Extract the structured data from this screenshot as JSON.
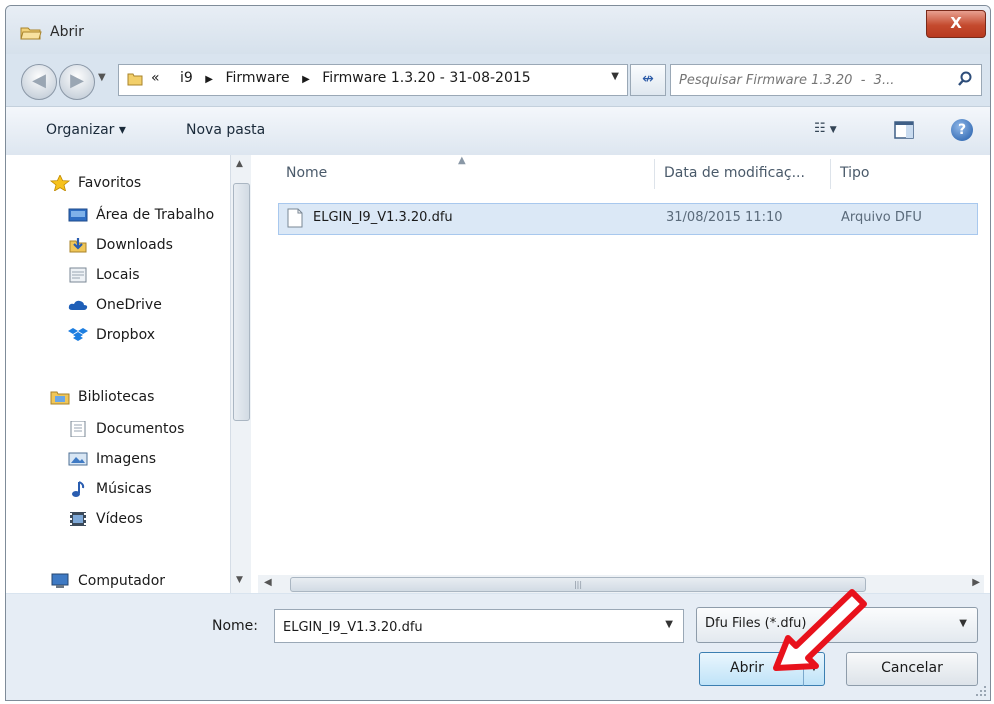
{
  "window": {
    "title": "Abrir",
    "close_label": "X"
  },
  "navbar": {
    "address": {
      "crumbs": [
        "«",
        "i9",
        "Firmware",
        "Firmware 1.3.20  -  31-08-2015"
      ]
    },
    "search_placeholder": "Pesquisar Firmware 1.3.20  -  3..."
  },
  "toolbar": {
    "organize_label": "Organizar ▾",
    "new_folder_label": "Nova pasta"
  },
  "sidebar": {
    "favorites": {
      "label": "Favoritos",
      "items": [
        {
          "label": "Área de Trabalho",
          "icon": "desktop-icon"
        },
        {
          "label": "Downloads",
          "icon": "downloads-icon"
        },
        {
          "label": "Locais",
          "icon": "recent-places-icon"
        },
        {
          "label": "OneDrive",
          "icon": "onedrive-icon"
        },
        {
          "label": "Dropbox",
          "icon": "dropbox-icon"
        }
      ]
    },
    "libraries": {
      "label": "Bibliotecas",
      "items": [
        {
          "label": "Documentos",
          "icon": "documents-icon"
        },
        {
          "label": "Imagens",
          "icon": "pictures-icon"
        },
        {
          "label": "Músicas",
          "icon": "music-icon"
        },
        {
          "label": "Vídeos",
          "icon": "videos-icon"
        }
      ]
    },
    "computer_label": "Computador"
  },
  "file_list": {
    "columns": {
      "name": "Nome",
      "date": "Data de modificaç...",
      "type": "Tipo"
    },
    "rows": [
      {
        "name": "ELGIN_I9_V1.3.20.dfu",
        "date": "31/08/2015 11:10",
        "type": "Arquivo DFU",
        "selected": true
      }
    ]
  },
  "bottom": {
    "name_label": "Nome:",
    "name_value": "ELGIN_I9_V1.3.20.dfu",
    "filter_label": "Dfu Files (*.dfu)",
    "open_label": "Abrir",
    "cancel_label": "Cancelar"
  },
  "colors": {
    "selection_bg": "#dbe8f6",
    "callout_arrow": "#e8121c"
  }
}
